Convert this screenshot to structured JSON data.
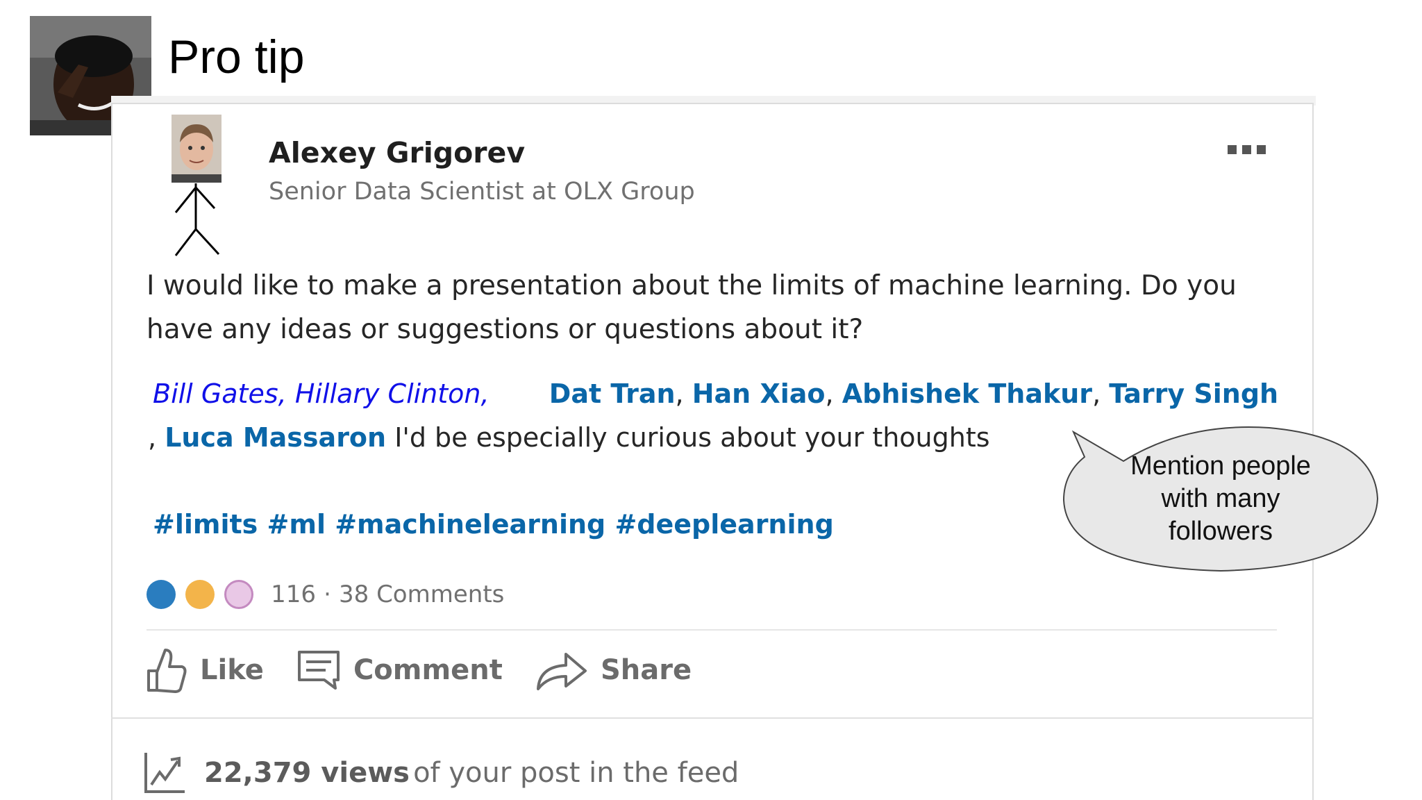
{
  "slide": {
    "title": "Pro tip"
  },
  "post": {
    "author_name": "Alexey Grigorev",
    "author_title": "Senior Data Scientist at OLX Group",
    "body": "I would like to make a presentation about the limits of machine learning. Do you have any ideas or suggestions or questions about it?",
    "handwritten_mentions": [
      "Bill Gates,",
      "Hillary Clinton,"
    ],
    "mentions": [
      "Dat Tran",
      "Han Xiao",
      "Abhishek Thakur",
      "Tarry Singh",
      "Luca Massaron"
    ],
    "mention_sep": ",",
    "mention_line2_prefix": ",",
    "mention_suffix": "I'd be especially curious about your thoughts",
    "hashtags": "#limits #ml #machinelearning #deeplearning",
    "reaction_icons": [
      "like-reaction-icon",
      "insightful-reaction-icon",
      "curious-reaction-icon"
    ],
    "reaction_count": "116",
    "reaction_sep": "·",
    "comments": "38 Comments",
    "actions": {
      "like": "Like",
      "comment": "Comment",
      "share": "Share"
    },
    "views_count": "22,379 views",
    "views_rest": "of your post in the feed"
  },
  "callout": {
    "text_lines": [
      "Mention people",
      "with many",
      "followers"
    ]
  },
  "colors": {
    "mention": "#0a66a8",
    "handwritten": "#1010e8",
    "muted": "#707070"
  }
}
